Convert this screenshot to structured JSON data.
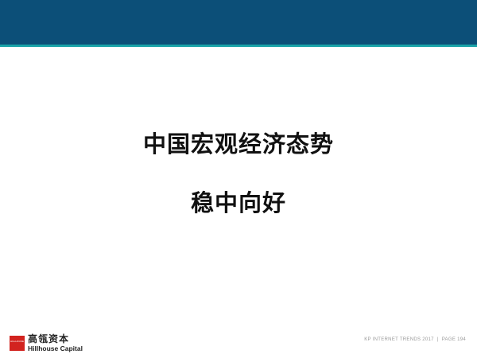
{
  "header": {
    "bar_color": "#0c4f78",
    "accent_color": "#1aa3a8"
  },
  "slide": {
    "title_line1": "中国宏观经济态势",
    "title_line2": "稳中向好"
  },
  "logo": {
    "mark_text": "HILLHOUSE",
    "mark_color": "#d2231f",
    "name_cn": "高瓴资本",
    "name_en": "Hillhouse Capital"
  },
  "footer": {
    "report": "KP INTERNET TRENDS 2017",
    "separator": "|",
    "page": "PAGE 194"
  }
}
